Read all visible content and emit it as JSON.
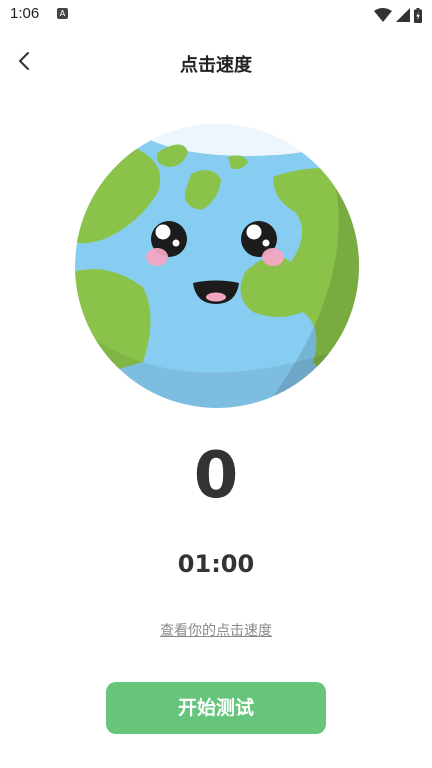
{
  "status_bar": {
    "time": "1:06",
    "notification_icon": "A",
    "icons": [
      "wifi-icon",
      "signal-icon",
      "battery-icon"
    ]
  },
  "header": {
    "title": "点击速度",
    "back_icon": "chevron-left-icon"
  },
  "main": {
    "illustration": "earth-mascot",
    "click_count": "0",
    "timer": "01:00",
    "speed_link": "查看你的点击速度",
    "start_button": "开始测试"
  },
  "colors": {
    "accent": "#66c47b",
    "ocean": "#87cdf2",
    "land": "#8bc34a"
  }
}
